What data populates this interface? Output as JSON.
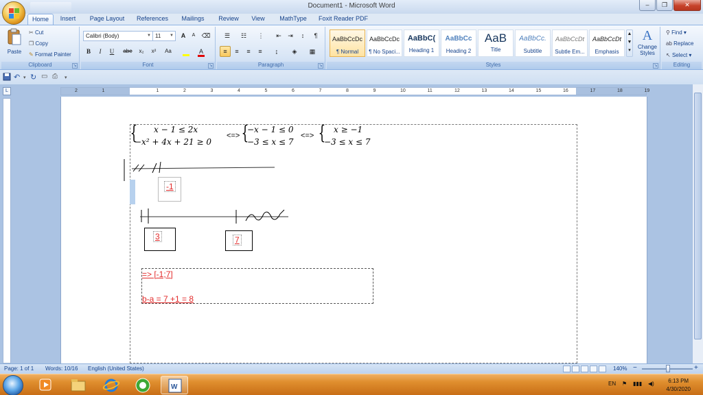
{
  "window": {
    "title": "Document1 - Microsoft Word",
    "minimize": "–",
    "restore": "❐",
    "close": "✕"
  },
  "tabs": [
    "Home",
    "Insert",
    "Page Layout",
    "References",
    "Mailings",
    "Review",
    "View",
    "MathType",
    "Foxit Reader PDF"
  ],
  "active_tab": "Home",
  "clipboard": {
    "paste": "Paste",
    "cut": "Cut",
    "copy": "Copy",
    "format_painter": "Format Painter",
    "label": "Clipboard"
  },
  "font": {
    "name": "Calibri (Body)",
    "size": "11",
    "bold": "B",
    "italic": "I",
    "underline": "U",
    "strike": "abe",
    "sub": "x₂",
    "sup": "x²",
    "case": "Aa",
    "grow": "A",
    "shrink": "A",
    "label": "Font"
  },
  "paragraph": {
    "label": "Paragraph",
    "pilcrow": "¶"
  },
  "styles": {
    "label": "Styles",
    "items": [
      {
        "sample": "AaBbCcDc",
        "name": "¶ Normal"
      },
      {
        "sample": "AaBbCcDc",
        "name": "¶ No Spaci..."
      },
      {
        "sample": "AaBbC(",
        "name": "Heading 1"
      },
      {
        "sample": "AaBbCc",
        "name": "Heading 2"
      },
      {
        "sample": "AaB",
        "name": "Title"
      },
      {
        "sample": "AaBbCc.",
        "name": "Subtitle"
      },
      {
        "sample": "AaBbCcDt",
        "name": "Subtle Em..."
      },
      {
        "sample": "AaBbCcDt",
        "name": "Emphasis"
      }
    ],
    "change": "Change Styles"
  },
  "editing": {
    "label": "Editing",
    "find": "Find",
    "replace": "Replace",
    "select": "Select"
  },
  "ruler": {
    "ticks": [
      "2",
      "1",
      "",
      "1",
      "2",
      "3",
      "4",
      "5",
      "6",
      "7",
      "8",
      "9",
      "10",
      "11",
      "12",
      "13",
      "14",
      "15",
      "16",
      "17",
      "18",
      "19"
    ]
  },
  "document": {
    "sys1_line1": "x − 1 ≤ 2x",
    "sys1_line2": "−x² + 4x + 21  ≥ 0",
    "arrow1": "<=>",
    "sys2_line1": "−x − 1 ≤ 0",
    "sys2_line2": "−3 ≤ x ≤ 7",
    "arrow2": "<=>",
    "sys3_line1": "x ≥ −1",
    "sys3_line2": "−3 ≤ x ≤ 7",
    "box_neg1": "-1",
    "box_3": "3",
    "box_7": "7",
    "answer1": "=> [-1;7]",
    "answer2": "b-a = 7 +1 = 8"
  },
  "status": {
    "page": "Page: 1 of 1",
    "words": "Words: 10/16",
    "language": "English (United States)",
    "zoom": "140%",
    "zoom_minus": "−",
    "zoom_plus": "+"
  },
  "taskbar": {
    "lang": "EN",
    "time": "6:13 PM",
    "date": "4/30/2020"
  }
}
